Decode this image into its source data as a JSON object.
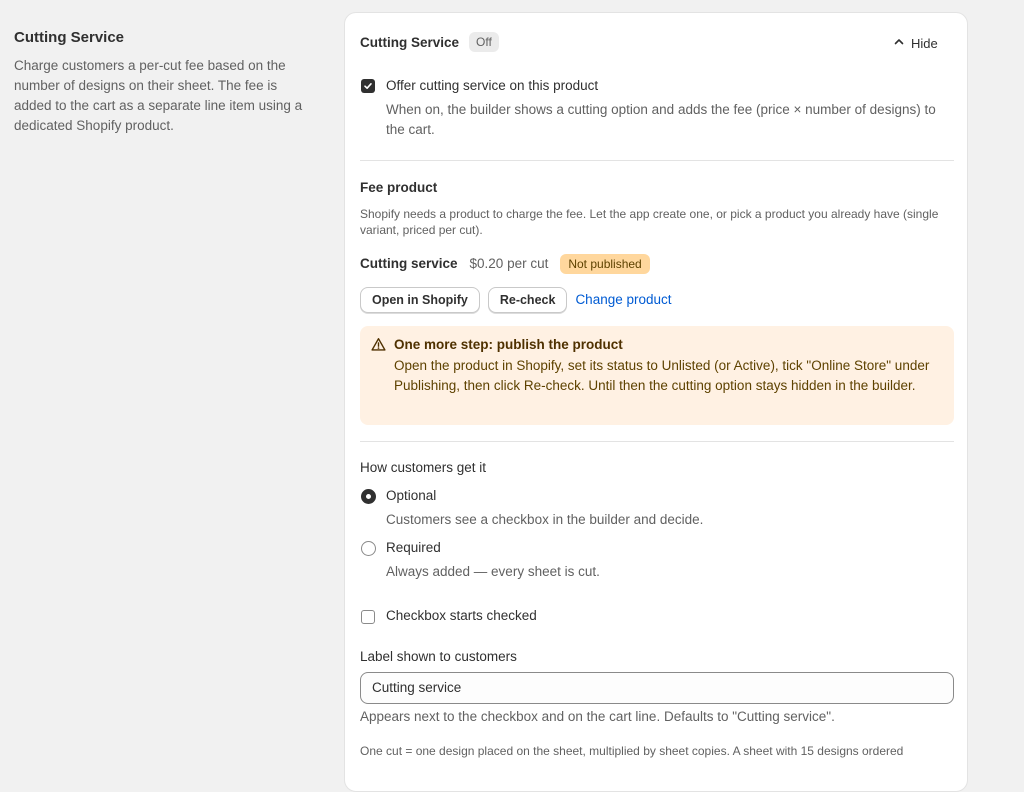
{
  "aside": {
    "title": "Cutting Service",
    "description": "Charge customers a per-cut fee based on the number of designs on their sheet. The fee is added to the cart as a separate line item using a dedicated Shopify product."
  },
  "card": {
    "title": "Cutting Service",
    "status_badge": "Off",
    "hide_label": "Hide",
    "offer": {
      "label": "Offer cutting service on this product",
      "checked": true,
      "help": "When on, the builder shows a cutting option and adds the fee (price × number of designs) to the cart."
    },
    "fee_product": {
      "title": "Fee product",
      "help": "Shopify needs a product to charge the fee. Let the app create one, or pick a product you already have (single variant, priced per cut).",
      "product_name": "Cutting service",
      "price": "$0.20 per cut",
      "publish_badge": "Not published",
      "buttons": {
        "open": "Open in Shopify",
        "recheck": "Re-check",
        "change": "Change product"
      }
    },
    "banner": {
      "title": "One more step: publish the product",
      "body": "Open the product in Shopify, set its status to Unlisted (or Active), tick \"Online Store\" under Publishing, then click Re-check. Until then the cutting option stays hidden in the builder."
    },
    "delivery": {
      "title": "How customers get it",
      "options": [
        {
          "label": "Optional",
          "help": "Customers see a checkbox in the builder and decide.",
          "selected": true
        },
        {
          "label": "Required",
          "help": "Always added — every sheet is cut.",
          "selected": false
        }
      ]
    },
    "starts_checked": {
      "label": "Checkbox starts checked",
      "checked": false
    },
    "customer_label": {
      "title": "Label shown to customers",
      "value": "Cutting service",
      "help": "Appears next to the checkbox and on the cart line. Defaults to \"Cutting service\"."
    },
    "footnote": "One cut = one design placed on the sheet, multiplied by sheet copies. A sheet with 15 designs ordered"
  },
  "colors": {
    "page_bg": "#f1f1f1",
    "card_bg": "#ffffff",
    "warning_bg": "#fff1e3",
    "warning_badge": "#ffd79d",
    "link": "#005bd3"
  }
}
